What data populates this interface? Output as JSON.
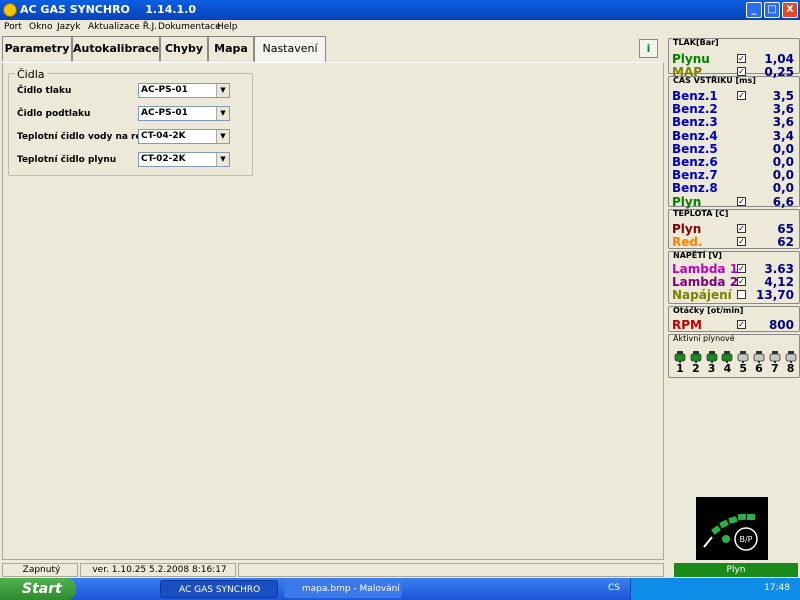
{
  "window": {
    "title": "AC GAS SYNCHRO    1.14.1.0",
    "minimize": "_",
    "maximize": "□",
    "close": "X"
  },
  "menu": [
    "Port",
    "Okno",
    "Jazyk",
    "Aktualizace Ř.J.",
    "Dokumentace",
    "Help"
  ],
  "tabs": [
    "Parametry",
    "Autokalibrace",
    "Chyby",
    "Mapa",
    "Nastavení"
  ],
  "active_tab": "Nastavení",
  "sensors": {
    "legend": "Čidla",
    "rows": [
      {
        "label": "Čidlo tlaku",
        "value": "AC-PS-01"
      },
      {
        "label": "Čidlo podtlaku",
        "value": "AC-PS-01"
      },
      {
        "label": "Teplotní čidlo vody na red.",
        "value": "CT-04-2K"
      },
      {
        "label": "Teplotní čidlo plynu",
        "value": "CT-02-2K"
      }
    ]
  },
  "status": {
    "state": "Zapnutý",
    "version": "ver. 1.10.25  5.2.2008 8:16:17"
  },
  "panel": {
    "pressure": {
      "header": "TLAK[Bar]",
      "rows": [
        {
          "label": "Plynu",
          "value": "1,04",
          "checked": true,
          "color": "#008000"
        },
        {
          "label": "MAP",
          "value": "0,25",
          "checked": true,
          "color": "#808000"
        }
      ]
    },
    "injection": {
      "header": "ČAS VSTŘIKU  [ms]",
      "rows": [
        {
          "label": "Benz.1",
          "value": "3,5",
          "checked": true,
          "color": "#0000c0"
        },
        {
          "label": "Benz.2",
          "value": "3,6",
          "checked": false,
          "color": "#0000c0"
        },
        {
          "label": "Benz.3",
          "value": "3,6",
          "checked": false,
          "color": "#0000c0"
        },
        {
          "label": "Benz.4",
          "value": "3,4",
          "checked": false,
          "color": "#0000c0"
        },
        {
          "label": "Benz.5",
          "value": "0,0",
          "checked": false,
          "color": "#0000c0"
        },
        {
          "label": "Benz.6",
          "value": "0,0",
          "checked": false,
          "color": "#0000c0"
        },
        {
          "label": "Benz.7",
          "value": "0,0",
          "checked": false,
          "color": "#0000c0"
        },
        {
          "label": "Benz.8",
          "value": "0,0",
          "checked": false,
          "color": "#0000c0"
        },
        {
          "label": "Plyn",
          "value": "6,6",
          "checked": true,
          "color": "#008000"
        }
      ]
    },
    "temperature": {
      "header": "TEPLOTA  [C]",
      "rows": [
        {
          "label": "Plyn",
          "value": "65",
          "checked": true,
          "color": "#800000"
        },
        {
          "label": "Red.",
          "value": "62",
          "checked": true,
          "color": "#ff8000"
        }
      ]
    },
    "voltage": {
      "header": "NAPĚTÍ [V]",
      "rows": [
        {
          "label": "Lambda 1",
          "value": "3.63",
          "checked": true,
          "color": "#c000c0"
        },
        {
          "label": "Lambda 2",
          "value": "4,12",
          "checked": true,
          "color": "#800080"
        },
        {
          "label": "Napájení",
          "value": "13,70",
          "checked": false,
          "color": "#808000"
        }
      ]
    },
    "rpm": {
      "header": "Otáčky [ot/min]",
      "rows": [
        {
          "label": "RPM",
          "value": "800",
          "checked": true,
          "color": "#c00000"
        }
      ]
    },
    "injectors": {
      "header": "Aktivní plynové",
      "numbers": [
        "1",
        "2",
        "3",
        "4",
        "5",
        "6",
        "7",
        "8"
      ],
      "active": [
        true,
        true,
        true,
        true,
        false,
        false,
        false,
        false
      ]
    },
    "mode": "Plyn"
  },
  "taskbar": {
    "start": "Start",
    "items": [
      "AC GAS SYNCHRO",
      "mapa.bmp - Malování"
    ],
    "lang": "CS",
    "clock": "17:48"
  }
}
